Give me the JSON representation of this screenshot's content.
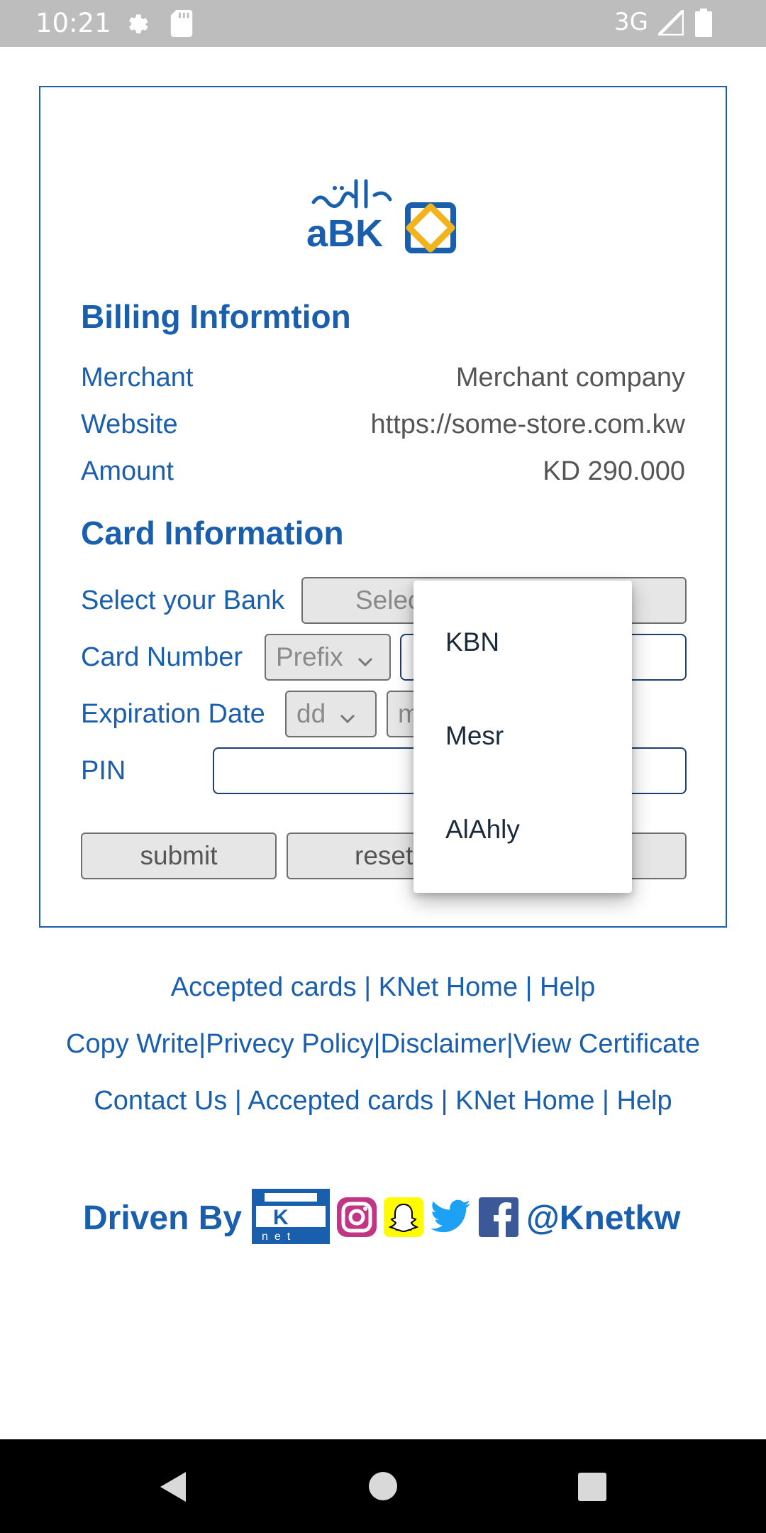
{
  "status_bar": {
    "time": "10:21",
    "network": "3G",
    "icons": [
      "gear-icon",
      "sd-card-icon",
      "signal-icon",
      "battery-icon"
    ]
  },
  "colors": {
    "brand_blue": "#1a5fae",
    "abk_gold": "#f2b41c",
    "status_bar": "#bdbdbd"
  },
  "billing": {
    "title": "Billing Informtion",
    "rows": [
      {
        "label": "Merchant",
        "value": "Merchant company"
      },
      {
        "label": "Website",
        "value": "https://some-store.com.kw"
      },
      {
        "label": "Amount",
        "value": "KD 290.000"
      }
    ]
  },
  "card_info": {
    "title": "Card Information",
    "bank_label": "Select your Bank",
    "bank_select_value": "Selec",
    "card_number_label": "Card Number",
    "prefix_value": "Prefix",
    "expiration_label": "Expiration Date",
    "day_value": "dd",
    "month_value": "m",
    "pin_label": "PIN",
    "submit_label": "submit",
    "reset_label": "reset"
  },
  "bank_dropdown": {
    "options": [
      "KBN",
      "Mesr",
      "AlAhly"
    ]
  },
  "footer": {
    "line1": "Accepted cards | KNet Home | Help",
    "line2": "Copy Write|Privecy Policy|Disclaimer|View Certificate",
    "line3": "Contact Us | Accepted cards | KNet Home | Help",
    "driven_by": "Driven By",
    "handle": "@Knetkw",
    "social_icons": [
      "knet-logo",
      "instagram-icon",
      "snapchat-icon",
      "twitter-icon",
      "facebook-icon"
    ]
  }
}
